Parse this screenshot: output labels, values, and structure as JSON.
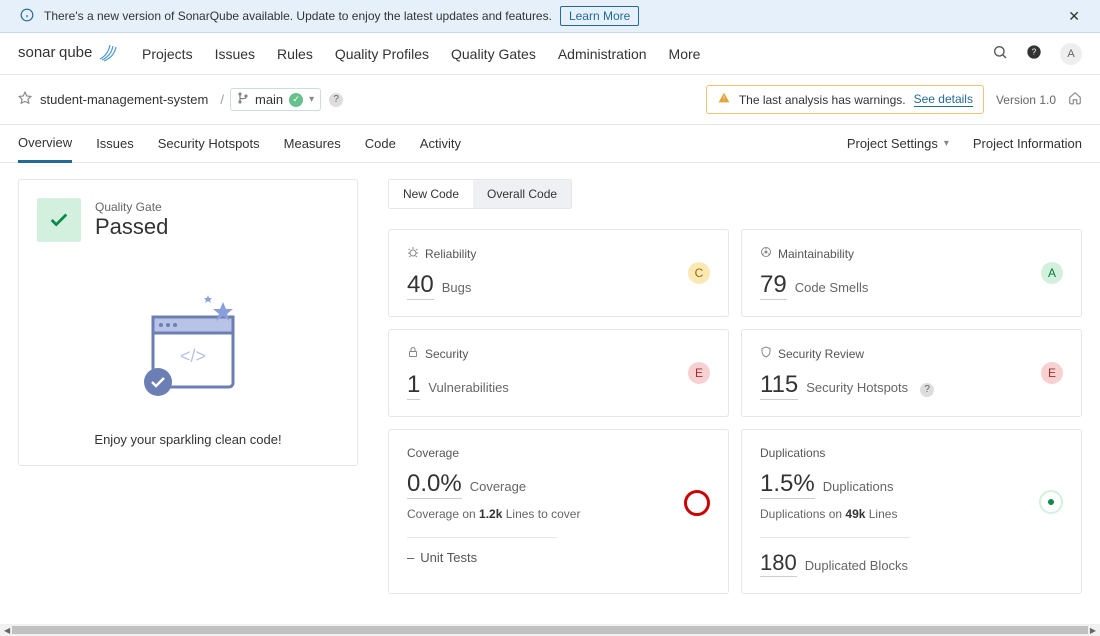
{
  "banner": {
    "text": "There's a new version of SonarQube available. Update to enjoy the latest updates and features.",
    "cta": "Learn More"
  },
  "nav": {
    "projects": "Projects",
    "issues": "Issues",
    "rules": "Rules",
    "quality_profiles": "Quality Profiles",
    "quality_gates": "Quality Gates",
    "administration": "Administration",
    "more": "More"
  },
  "user_initial": "A",
  "project": {
    "name": "student-management-system",
    "branch": "main",
    "version": "Version 1.0",
    "warning_text": "The last analysis has warnings.",
    "see_details": "See details"
  },
  "tabs": {
    "overview": "Overview",
    "issues": "Issues",
    "hotspots": "Security Hotspots",
    "measures": "Measures",
    "code": "Code",
    "activity": "Activity",
    "project_settings": "Project Settings",
    "project_info": "Project Information"
  },
  "quality_gate": {
    "label": "Quality Gate",
    "status": "Passed",
    "caption": "Enjoy your sparkling clean code!"
  },
  "code_tabs": {
    "new": "New Code",
    "overall": "Overall Code"
  },
  "metrics": {
    "reliability": {
      "title": "Reliability",
      "value": "40",
      "label": "Bugs",
      "rating": "C"
    },
    "maintainability": {
      "title": "Maintainability",
      "value": "79",
      "label": "Code Smells",
      "rating": "A"
    },
    "security": {
      "title": "Security",
      "value": "1",
      "label": "Vulnerabilities",
      "rating": "E"
    },
    "security_review": {
      "title": "Security Review",
      "value": "115",
      "label": "Security Hotspots",
      "rating": "E"
    },
    "coverage": {
      "title": "Coverage",
      "value": "0.0%",
      "label": "Coverage",
      "sub_prefix": "Coverage on ",
      "sub_bold": "1.2k",
      "sub_suffix": " Lines to cover",
      "unit_tests": "Unit Tests"
    },
    "duplications": {
      "title": "Duplications",
      "value": "1.5%",
      "label": "Duplications",
      "sub_prefix": "Duplications on ",
      "sub_bold": "49k",
      "sub_suffix": " Lines",
      "blocks_value": "180",
      "blocks_label": "Duplicated Blocks"
    }
  }
}
